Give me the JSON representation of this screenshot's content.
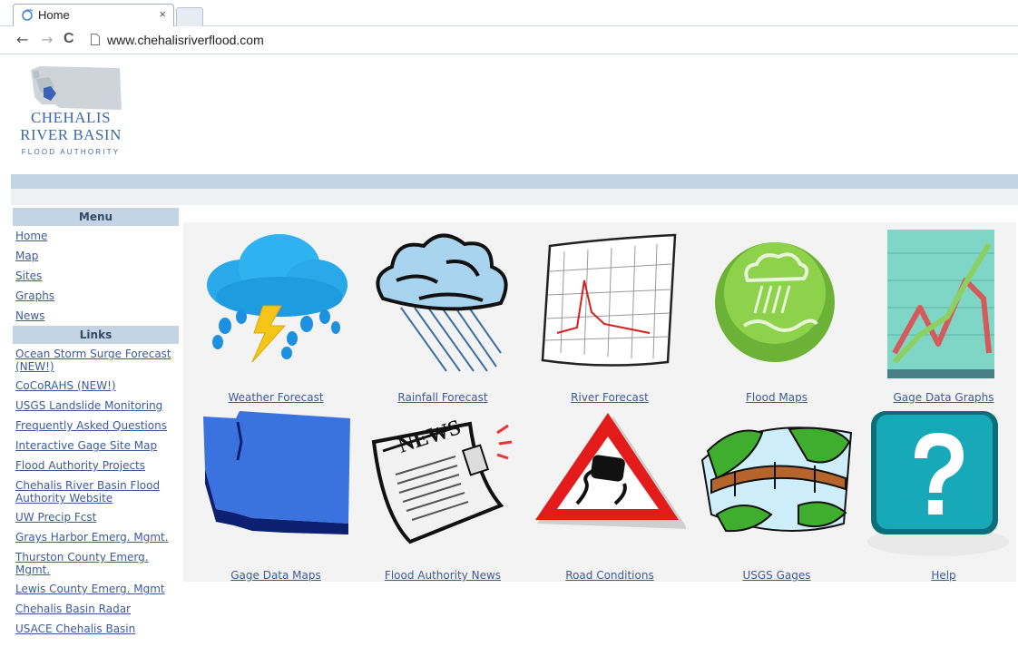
{
  "browser": {
    "tab_title": "Home",
    "tab_close": "×",
    "url": "www.chehalisriverflood.com",
    "back": "←",
    "forward": "→",
    "reload": "C"
  },
  "logo": {
    "line1": "CHEHALIS",
    "line2": "RIVER BASIN",
    "line3": "FLOOD AUTHORITY"
  },
  "menu": {
    "heading": "Menu",
    "items": [
      "Home",
      "Map",
      "Sites",
      "Graphs",
      "News"
    ]
  },
  "links": {
    "heading": "Links",
    "items": [
      "Ocean Storm Surge Forecast (NEW!)",
      "CoCoRAHS (NEW!)",
      "USGS Landslide Monitoring",
      "Frequently Asked Questions",
      "Interactive Gage Site Map",
      "Flood Authority Projects",
      "Chehalis River Basin Flood Authority Website",
      "UW Precip Fcst",
      "Grays Harbor Emerg. Mgmt.",
      "Thurston County Emerg. Mgmt.",
      "Lewis County Emerg. Mgmt",
      "Chehalis Basin Radar",
      "USACE Chehalis Basin"
    ]
  },
  "tiles": [
    {
      "label": "Weather Forecast",
      "icon": "storm-cloud-icon"
    },
    {
      "label": "Rainfall Forecast",
      "icon": "rain-cloud-icon"
    },
    {
      "label": "River Forecast",
      "icon": "hydrograph-icon"
    },
    {
      "label": "Flood Maps",
      "icon": "flood-map-icon"
    },
    {
      "label": "Gage Data Graphs",
      "icon": "line-graph-icon"
    },
    {
      "label": "Gage Data Maps",
      "icon": "washington-map-icon"
    },
    {
      "label": "Flood Authority News",
      "icon": "newspaper-icon"
    },
    {
      "label": "Road Conditions",
      "icon": "slippery-road-sign-icon"
    },
    {
      "label": "USGS Gages",
      "icon": "river-bridge-icon"
    },
    {
      "label": "Help",
      "icon": "help-icon"
    }
  ],
  "colors": {
    "band": "#c5d4e4",
    "link": "#3b5b9a",
    "logo": "#3e6aa5"
  }
}
